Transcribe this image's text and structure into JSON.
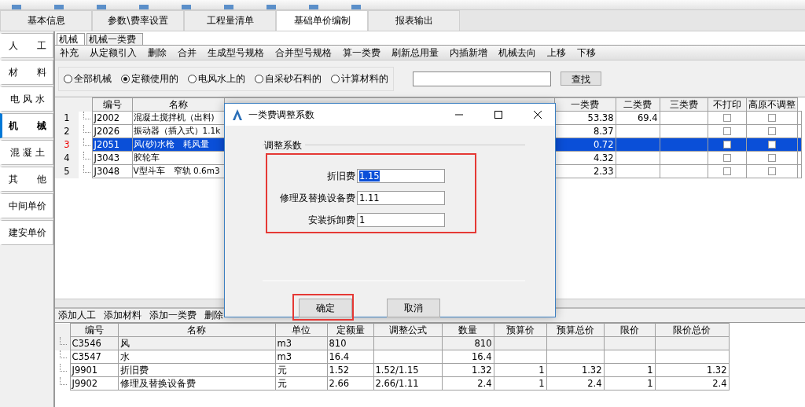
{
  "main_tabs": [
    {
      "label": "基本信息",
      "selected": false
    },
    {
      "label": "参数\\费率设置",
      "selected": false
    },
    {
      "label": "工程量清单",
      "selected": false
    },
    {
      "label": "基础单价编制",
      "selected": true
    },
    {
      "label": "报表输出",
      "selected": false
    }
  ],
  "sidebar": {
    "items": [
      {
        "label": "人　　工",
        "selected": false
      },
      {
        "label": "材　　料",
        "selected": false
      },
      {
        "label": "电 风 水",
        "selected": false
      },
      {
        "label": "机　　械",
        "selected": true
      },
      {
        "label": "混 凝 土",
        "selected": false
      },
      {
        "label": "其　　他",
        "selected": false
      },
      {
        "label": "中间单价",
        "selected": false
      },
      {
        "label": "建安单价",
        "selected": false
      }
    ]
  },
  "sub_tabs": [
    {
      "label": "机械",
      "selected": true
    },
    {
      "label": "机械一类费",
      "selected": false
    }
  ],
  "toolbar": [
    "补充",
    "从定额引入",
    "删除",
    "合并",
    "生成型号规格",
    "合并型号规格",
    "算一类费",
    "刷新总用量",
    "内插新增",
    "机械去向",
    "上移",
    "下移"
  ],
  "filter": {
    "options": [
      {
        "label": "全部机械",
        "selected": false
      },
      {
        "label": "定额使用的",
        "selected": true
      },
      {
        "label": "电风水上的",
        "selected": false
      },
      {
        "label": "自采砂石料的",
        "selected": false
      },
      {
        "label": "计算材料的",
        "selected": false
      }
    ],
    "search_button": "查找"
  },
  "machine_table": {
    "columns": [
      "编号",
      "名称",
      "一类费",
      "二类费",
      "三类费",
      "不打印",
      "高原不调整"
    ],
    "rows": [
      {
        "row_number": "1",
        "code": "J2002",
        "name": "混凝土搅拌机（出料)",
        "class_1_fee": "53.38",
        "class_2_fee": "69.4",
        "no_print": false,
        "no_altitude_adjust": false,
        "selected": false
      },
      {
        "row_number": "2",
        "code": "J2026",
        "name": "振动器（插入式）1.1k",
        "class_1_fee": "8.37",
        "no_print": false,
        "no_altitude_adjust": false,
        "selected": false
      },
      {
        "row_number": "3",
        "code": "J2051",
        "name": "风(砂)水枪　耗风量",
        "class_1_fee": "0.72",
        "no_print": false,
        "no_altitude_adjust": false,
        "selected": true
      },
      {
        "row_number": "4",
        "code": "J3043",
        "name": "胶轮车",
        "class_1_fee": "4.32",
        "no_print": false,
        "no_altitude_adjust": false,
        "selected": false
      },
      {
        "row_number": "5",
        "code": "J3048",
        "name": "V型斗车　窄轨 0.6m3",
        "class_1_fee": "2.33",
        "no_print": false,
        "no_altitude_adjust": false,
        "selected": false
      }
    ]
  },
  "dialog": {
    "title": "一类费调整系数",
    "group_title": "调整系数",
    "highlighted": true,
    "fields": [
      {
        "label": "折旧费",
        "value": "1.15",
        "text_selected": true
      },
      {
        "label": "修理及替换设备费",
        "value": "1.11",
        "text_selected": false
      },
      {
        "label": "安装拆卸费",
        "value": "1",
        "text_selected": false
      }
    ],
    "buttons": [
      {
        "label": "确定",
        "highlighted": true
      },
      {
        "label": "取消",
        "highlighted": false
      }
    ]
  },
  "detail_toolbar": [
    "添加人工",
    "添加材料",
    "添加一类费",
    "删除"
  ],
  "detail_table": {
    "columns": [
      "编号",
      "名称",
      "单位",
      "定额量",
      "调整公式",
      "数量",
      "预算价",
      "预算总价",
      "限价",
      "限价总价"
    ],
    "rows": [
      {
        "cells": [
          "C3546",
          "风",
          "m3",
          "810",
          "",
          "810",
          "",
          "",
          "",
          ""
        ]
      },
      {
        "cells": [
          "C3547",
          "水",
          "m3",
          "16.4",
          "",
          "16.4",
          "",
          "",
          "",
          ""
        ]
      },
      {
        "cells": [
          "J9901",
          "折旧费",
          "元",
          "1.52",
          "1.52/1.15",
          "1.32",
          "1",
          "1.32",
          "1",
          "1.32"
        ]
      },
      {
        "cells": [
          "J9902",
          "修理及替换设备费",
          "元",
          "2.66",
          "2.66/1.11",
          "2.4",
          "1",
          "2.4",
          "1",
          "2.4"
        ]
      }
    ]
  }
}
